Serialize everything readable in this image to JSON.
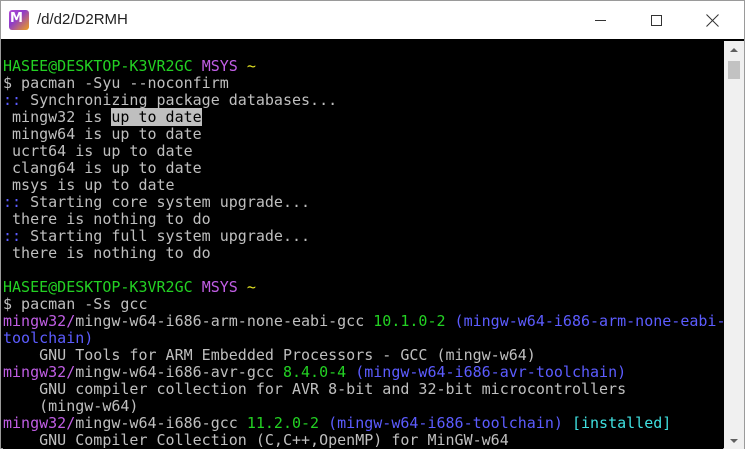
{
  "window": {
    "title": "/d/d2/D2RMH",
    "icon_label": "M"
  },
  "terminal": {
    "lines": [
      [
        {
          "t": "",
          "c": "gray"
        }
      ],
      [
        {
          "t": "HASEE@DESKTOP-K3VR2GC ",
          "c": "green"
        },
        {
          "t": "MSYS ",
          "c": "purple"
        },
        {
          "t": "~",
          "c": "yellow"
        }
      ],
      [
        {
          "t": "$ pacman -Syu --noconfirm",
          "c": "gray"
        }
      ],
      [
        {
          "t": "::",
          "c": "blue"
        },
        {
          "t": " Synchronizing package databases...",
          "c": "gray"
        }
      ],
      [
        {
          "t": " mingw32 is ",
          "c": "gray"
        },
        {
          "t": "up to date",
          "c": "sel"
        }
      ],
      [
        {
          "t": " mingw64 is up to date",
          "c": "gray"
        }
      ],
      [
        {
          "t": " ucrt64 is up to date",
          "c": "gray"
        }
      ],
      [
        {
          "t": " clang64 is up to date",
          "c": "gray"
        }
      ],
      [
        {
          "t": " msys is up to date",
          "c": "gray"
        }
      ],
      [
        {
          "t": "::",
          "c": "blue"
        },
        {
          "t": " Starting core system upgrade...",
          "c": "gray"
        }
      ],
      [
        {
          "t": " there is nothing to do",
          "c": "gray"
        }
      ],
      [
        {
          "t": "::",
          "c": "blue"
        },
        {
          "t": " Starting full system upgrade...",
          "c": "gray"
        }
      ],
      [
        {
          "t": " there is nothing to do",
          "c": "gray"
        }
      ],
      [
        {
          "t": "",
          "c": "gray"
        }
      ],
      [
        {
          "t": "HASEE@DESKTOP-K3VR2GC ",
          "c": "green"
        },
        {
          "t": "MSYS ",
          "c": "purple"
        },
        {
          "t": "~",
          "c": "yellow"
        }
      ],
      [
        {
          "t": "$ pacman -Ss gcc",
          "c": "gray"
        }
      ],
      [
        {
          "t": "mingw32/",
          "c": "purple"
        },
        {
          "t": "mingw-w64-i686-arm-none-eabi-gcc ",
          "c": "gray"
        },
        {
          "t": "10.1.0-2 ",
          "c": "green"
        },
        {
          "t": "(mingw-w64-i686-arm-none-eabi-",
          "c": "blue"
        }
      ],
      [
        {
          "t": "toolchain)",
          "c": "blue"
        }
      ],
      [
        {
          "t": "    GNU Tools for ARM Embedded Processors - GCC (mingw-w64)",
          "c": "gray"
        }
      ],
      [
        {
          "t": "mingw32/",
          "c": "purple"
        },
        {
          "t": "mingw-w64-i686-avr-gcc ",
          "c": "gray"
        },
        {
          "t": "8.4.0-4 ",
          "c": "green"
        },
        {
          "t": "(mingw-w64-i686-avr-toolchain)",
          "c": "blue"
        }
      ],
      [
        {
          "t": "    GNU compiler collection for AVR 8-bit and 32-bit microcontrollers",
          "c": "gray"
        }
      ],
      [
        {
          "t": "    (mingw-w64)",
          "c": "gray"
        }
      ],
      [
        {
          "t": "mingw32/",
          "c": "purple"
        },
        {
          "t": "mingw-w64-i686-gcc ",
          "c": "gray"
        },
        {
          "t": "11.2.0-2 ",
          "c": "green"
        },
        {
          "t": "(mingw-w64-i686-toolchain) ",
          "c": "blue"
        },
        {
          "t": "[installed]",
          "c": "cyan"
        }
      ],
      [
        {
          "t": "    GNU Compiler Collection (C,C++,OpenMP) for MinGW-w64",
          "c": "gray"
        }
      ]
    ]
  },
  "colors": {
    "green": "#23d123",
    "purple": "#c15ee5",
    "yellow": "#e5e522",
    "blue": "#5c5cff",
    "cyan": "#3fe0e0",
    "gray": "#bfbfbf",
    "background": "#000000"
  },
  "icons": {
    "minimize": "minimize-icon",
    "maximize": "maximize-icon",
    "close": "close-icon"
  }
}
